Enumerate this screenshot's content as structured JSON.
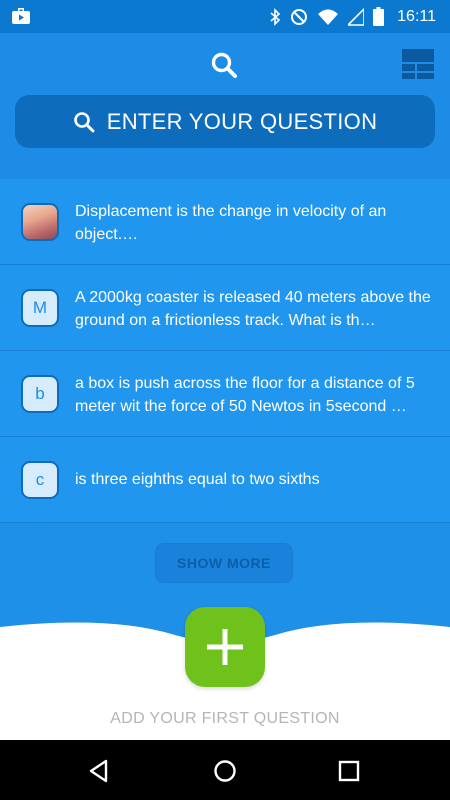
{
  "status_bar": {
    "time": "16:11",
    "icons": [
      "play-store-icon",
      "bluetooth-icon",
      "do-not-disturb-icon",
      "wifi-icon",
      "cellular-icon",
      "battery-icon"
    ]
  },
  "header": {
    "search_placeholder": "ENTER YOUR QUESTION",
    "icons": [
      "search-icon",
      "layout-grid-icon"
    ]
  },
  "questions": [
    {
      "avatar": "photo",
      "text": "Displacement is the change in velocity of an object.…"
    },
    {
      "avatar": "M",
      "text": "A 2000kg coaster is released 40 meters above the ground on a frictionless track. What is th…"
    },
    {
      "avatar": "b",
      "text": "a box is push across the floor for a distance of 5 meter wit the force of 50 Newtos in 5second …"
    },
    {
      "avatar": "c",
      "text": "is three eighths equal to two sixths"
    }
  ],
  "show_more_label": "SHOW MORE",
  "add_question_label": "ADD YOUR FIRST QUESTION",
  "colors": {
    "header_bg": "#1d8ce6",
    "status_bg": "#0c79d1",
    "search_bar_bg": "#0d6dbc",
    "fab_bg": "#6fc21b",
    "nav_bg": "#000000"
  },
  "nav": [
    "back-icon",
    "home-icon",
    "recents-icon"
  ]
}
